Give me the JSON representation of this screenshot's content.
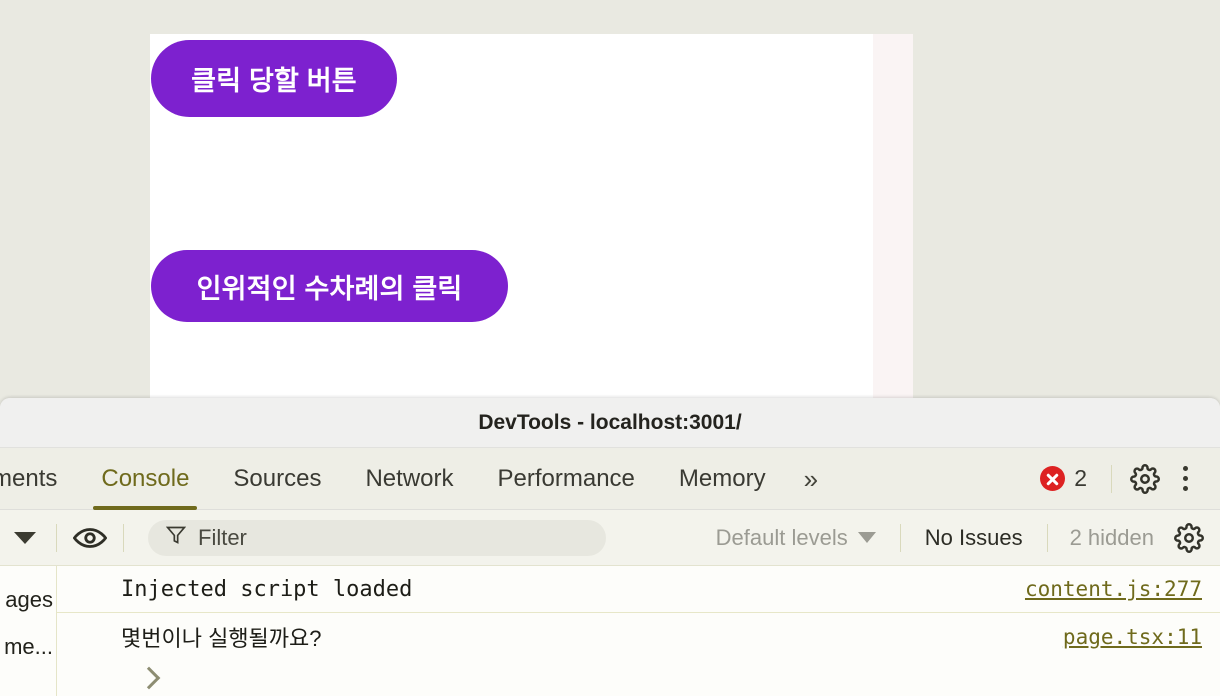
{
  "page": {
    "buttons": [
      {
        "id": "click-target",
        "label": "클릭 당할 버튼",
        "color": "#7d21cf"
      },
      {
        "id": "auto-click",
        "label": "인위적인 수차례의 클릭",
        "color": "#7d21cf"
      }
    ]
  },
  "devtools": {
    "window_title": "DevTools - localhost:3001/",
    "tabs": [
      {
        "name": "elements",
        "label": "ments",
        "active": false,
        "truncated": true
      },
      {
        "name": "console",
        "label": "Console",
        "active": true,
        "truncated": false
      },
      {
        "name": "sources",
        "label": "Sources",
        "active": false,
        "truncated": false
      },
      {
        "name": "network",
        "label": "Network",
        "active": false,
        "truncated": false
      },
      {
        "name": "performance",
        "label": "Performance",
        "active": false,
        "truncated": false
      },
      {
        "name": "memory",
        "label": "Memory",
        "active": false,
        "truncated": false
      }
    ],
    "more_tabs_icon": "»",
    "error_badge": {
      "icon": "error-circle-icon",
      "count": "2",
      "color": "#dd2222"
    },
    "settings_icon": "gear-icon",
    "more_options_icon": "kebab-menu-icon",
    "toolbar": {
      "console_settings_caret": "chevron-down-icon",
      "eye_icon": "eye-icon",
      "filter": {
        "icon": "funnel-icon",
        "value": "",
        "placeholder": "Filter"
      },
      "levels": {
        "label": "Default levels",
        "caret": "chevron-down-icon"
      },
      "issues": "No Issues",
      "hidden": "2 hidden",
      "settings_icon": "gear-icon"
    },
    "sidebar": [
      {
        "name": "messages",
        "label": "ages"
      },
      {
        "name": "user-messages",
        "label": "me..."
      }
    ],
    "messages": [
      {
        "text": "Injected script loaded",
        "mono": true,
        "source": "content.js:277"
      },
      {
        "text": "몇번이나  실행될까요?",
        "mono": false,
        "source": "page.tsx:11"
      }
    ],
    "prompt_icon": "prompt-chevron-icon"
  },
  "colors": {
    "accent_purple": "#7d21cf",
    "active_tab": "#6f6a1c",
    "error_red": "#dd2222",
    "link": "#6f6a1c"
  }
}
